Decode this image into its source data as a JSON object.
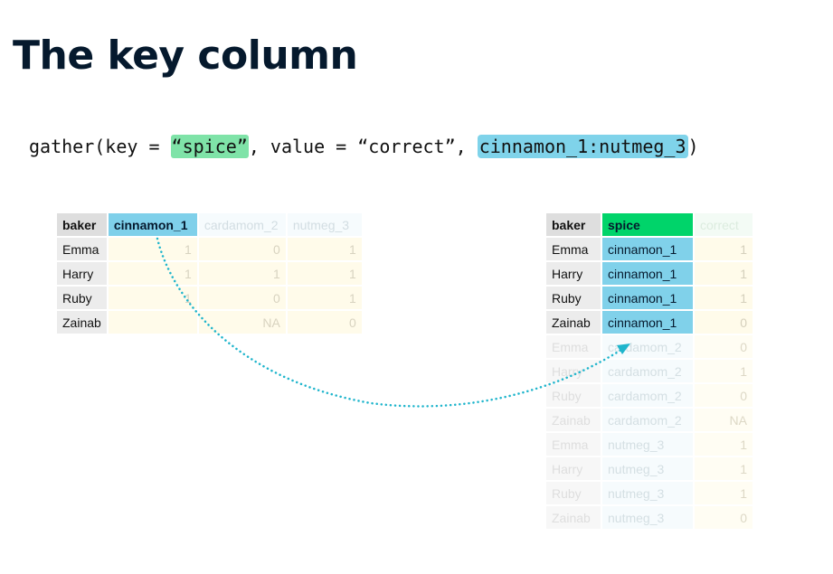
{
  "title": "The key column",
  "code": {
    "prefix": "gather(key = ",
    "key_arg": "“spice”",
    "middle": ", value = “correct”, ",
    "cols_arg": "cinnamon_1:nutmeg_3",
    "suffix": ")"
  },
  "colors": {
    "key_highlight": "#7fe3a8",
    "cols_highlight": "#7fd3ea",
    "arrow": "#1fb5cc",
    "spice_header": "#00d46a"
  },
  "wide_table": {
    "headers": [
      "baker",
      "cinnamon_1",
      "cardamom_2",
      "nutmeg_3"
    ],
    "rows": [
      [
        "Emma",
        "1",
        "0",
        "1"
      ],
      [
        "Harry",
        "1",
        "1",
        "1"
      ],
      [
        "Ruby",
        "1",
        "0",
        "1"
      ],
      [
        "Zainab",
        "",
        "NA",
        "0"
      ]
    ]
  },
  "long_table": {
    "headers": [
      "baker",
      "spice",
      "correct"
    ],
    "rows": [
      [
        "Emma",
        "cinnamon_1",
        "1"
      ],
      [
        "Harry",
        "cinnamon_1",
        "1"
      ],
      [
        "Ruby",
        "cinnamon_1",
        "1"
      ],
      [
        "Zainab",
        "cinnamon_1",
        "0"
      ],
      [
        "Emma",
        "cardamom_2",
        "0"
      ],
      [
        "Harry",
        "cardamom_2",
        "1"
      ],
      [
        "Ruby",
        "cardamom_2",
        "0"
      ],
      [
        "Zainab",
        "cardamom_2",
        "NA"
      ],
      [
        "Emma",
        "nutmeg_3",
        "1"
      ],
      [
        "Harry",
        "nutmeg_3",
        "1"
      ],
      [
        "Ruby",
        "nutmeg_3",
        "1"
      ],
      [
        "Zainab",
        "nutmeg_3",
        "0"
      ]
    ]
  }
}
